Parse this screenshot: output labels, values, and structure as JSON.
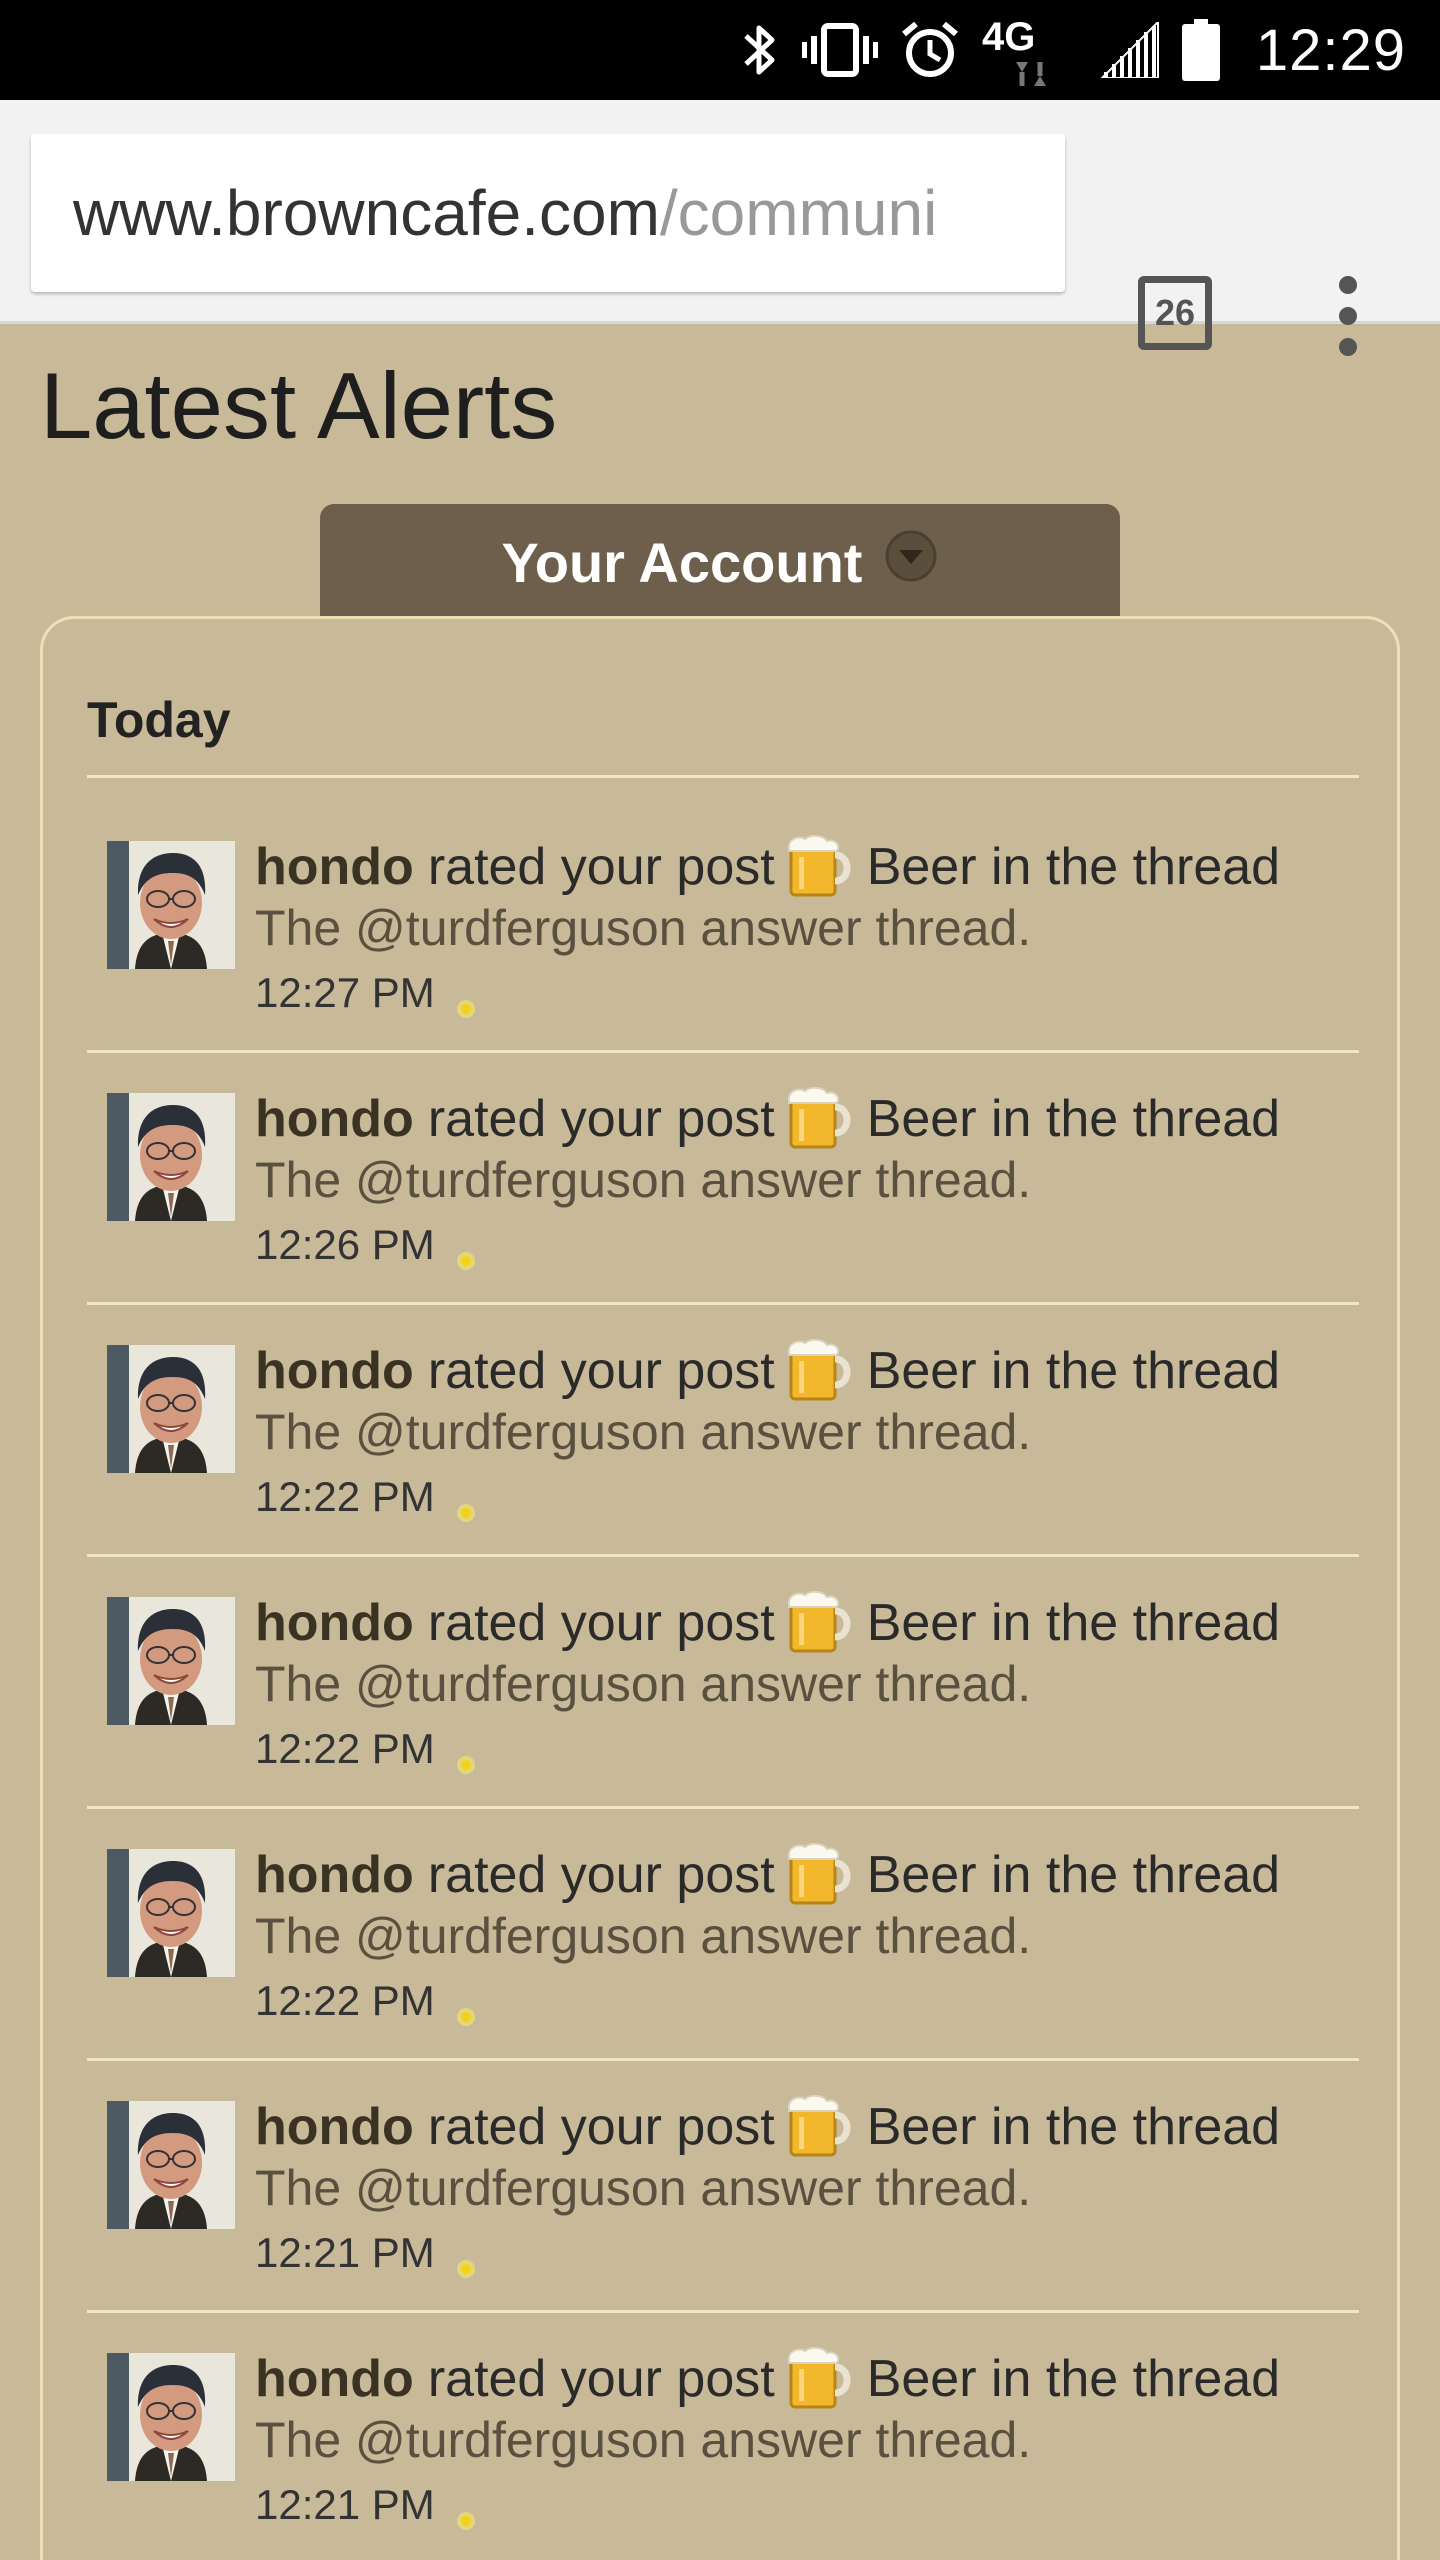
{
  "status_bar": {
    "time": "12:29",
    "network": "4G",
    "icons": [
      "bluetooth-icon",
      "vibrate-icon",
      "alarm-icon",
      "lte-icon",
      "signal-icon",
      "battery-icon"
    ]
  },
  "browser": {
    "url_domain": "www.browncafe.com",
    "url_path": "/communi",
    "tab_count": "26",
    "menu_icon": "kebab-menu-icon"
  },
  "page": {
    "title": "Latest Alerts",
    "account_tab_label": "Your Account",
    "section_label": "Today"
  },
  "colors": {
    "page_bg": "#c8ba98",
    "tab_bg": "#6d5f4b",
    "divider": "#f0e6c4"
  },
  "alerts": [
    {
      "user": "hondo",
      "action": "rated your post",
      "rating": "Beer",
      "context": "in the thread",
      "thread": "The @turdferguson answer thread.",
      "time": "12:27 PM"
    },
    {
      "user": "hondo",
      "action": "rated your post",
      "rating": "Beer",
      "context": "in the thread",
      "thread": "The @turdferguson answer thread.",
      "time": "12:26 PM"
    },
    {
      "user": "hondo",
      "action": "rated your post",
      "rating": "Beer",
      "context": "in the thread",
      "thread": "The @turdferguson answer thread.",
      "time": "12:22 PM"
    },
    {
      "user": "hondo",
      "action": "rated your post",
      "rating": "Beer",
      "context": "in the thread",
      "thread": "The @turdferguson answer thread.",
      "time": "12:22 PM"
    },
    {
      "user": "hondo",
      "action": "rated your post",
      "rating": "Beer",
      "context": "in the thread",
      "thread": "The @turdferguson answer thread.",
      "time": "12:22 PM"
    },
    {
      "user": "hondo",
      "action": "rated your post",
      "rating": "Beer",
      "context": "in the thread",
      "thread": "The @turdferguson answer thread.",
      "time": "12:21 PM"
    },
    {
      "user": "hondo",
      "action": "rated your post",
      "rating": "Beer",
      "context": "in the thread",
      "thread": "The @turdferguson answer thread.",
      "time": "12:21 PM"
    }
  ]
}
